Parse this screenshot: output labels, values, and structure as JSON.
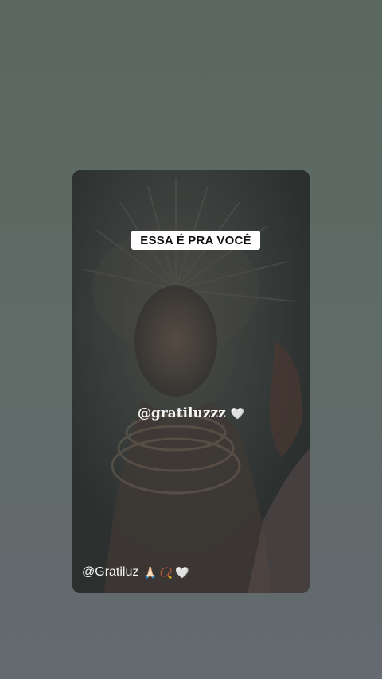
{
  "story": {
    "title": "ESSA É PRA VOCÊ",
    "center_handle": "@gratiluzzz",
    "center_emoji": "🤍",
    "bottom_handle": "@Gratiluz",
    "bottom_emojis": [
      "🙏🏻",
      "📿",
      "🤍"
    ]
  },
  "colors": {
    "page_bg_top": "#5a685f",
    "page_bg_bottom": "#646a70",
    "card_bg": "#353b3a",
    "pill_bg": "#ffffff",
    "text_light": "#f4f4f4"
  }
}
